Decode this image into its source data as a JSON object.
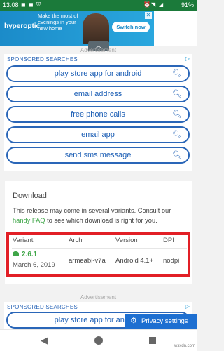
{
  "status_bar": {
    "time": "13:08",
    "notif_icons": [
      "app-notification-icon",
      "app-notification-icon",
      "shield-icon"
    ],
    "battery": "91%"
  },
  "top_ad": {
    "brand": "hyperoptic",
    "tagline": "Make the most of evenings in your new home",
    "cta": "Switch now",
    "accent_color": "#1b8bc9"
  },
  "ad_labels": {
    "advertisement_top": "Advertisement",
    "advertisement_bottom": "Advertisement"
  },
  "sponsored": {
    "heading": "SPONSORED SEARCHES",
    "items": [
      {
        "label": "play store app for android"
      },
      {
        "label": "email address"
      },
      {
        "label": "free phone calls"
      },
      {
        "label": "email app"
      },
      {
        "label": "send sms message"
      }
    ],
    "bottom_items": [
      {
        "label": "play store app for android"
      }
    ]
  },
  "download": {
    "title": "Download",
    "desc_before": "This release may come in several variants. Consult our ",
    "desc_link": "handy FAQ",
    "desc_after": " to see which download is right for you.",
    "headers": [
      "Variant",
      "Arch",
      "Version",
      "DPI"
    ],
    "row": {
      "variant": "2.6.1",
      "date": "March 6, 2019",
      "arch": "armeabi-v7a",
      "version": "Android 4.1+",
      "dpi": "nodpi"
    },
    "link_color": "#3fa648",
    "highlight_color": "#e21f26"
  },
  "privacy": {
    "label": "Privacy settings"
  },
  "watermark": "wsxdn.com"
}
